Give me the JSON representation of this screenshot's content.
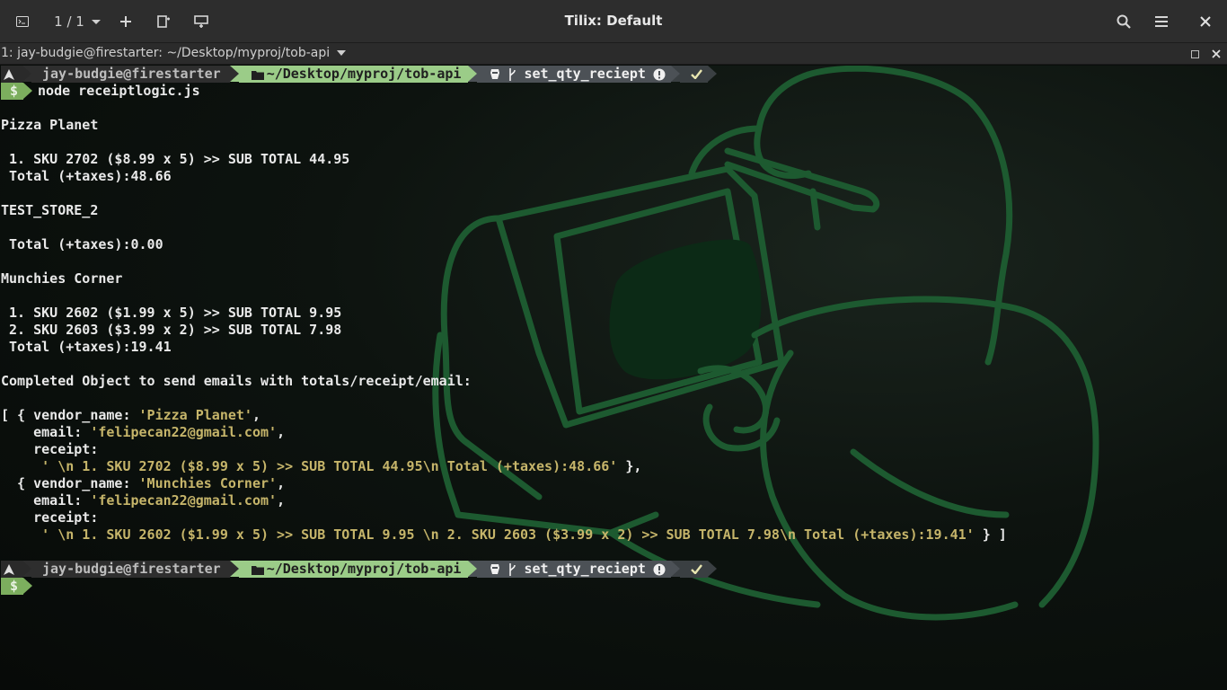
{
  "header": {
    "session_counter": "1 / 1",
    "window_title": "Tilix: Default"
  },
  "terminal_bar": {
    "title": "1: jay-budgie@firestarter: ~/Desktop/myproj/tob-api"
  },
  "prompt": {
    "user_host": "jay-budgie@firestarter",
    "directory": "~/Desktop/myproj/tob-api",
    "branch": "set_qty_reciept",
    "dollar": "$"
  },
  "command": "node receiptlogic.js",
  "output": {
    "store1_name": "Pizza Planet",
    "store1_item1": " 1. SKU 2702 ($8.99 x 5) >> SUB TOTAL 44.95",
    "store1_total": " Total (+taxes):48.66",
    "store2_name": "TEST_STORE_2",
    "store2_total": " Total (+taxes):0.00",
    "store3_name": "Munchies Corner",
    "store3_item1": " 1. SKU 2602 ($1.99 x 5) >> SUB TOTAL 9.95",
    "store3_item2": " 2. SKU 2603 ($3.99 x 2) >> SUB TOTAL 7.98",
    "store3_total": " Total (+taxes):19.41",
    "completed_heading": "Completed Object to send emails with totals/receipt/email:",
    "obj1_vendor_key": "[ { vendor_name: ",
    "obj1_vendor_val": "'Pizza Planet'",
    "obj1_email_key": "    email: ",
    "obj1_email_val": "'felipecan22@gmail.com'",
    "obj_receipt_key": "    receipt:",
    "obj1_receipt_val": "     ' \\n 1. SKU 2702 ($8.99 x 5) >> SUB TOTAL 44.95\\n Total (+taxes):48.66'",
    "obj1_close": " },",
    "obj2_vendor_key": "  { vendor_name: ",
    "obj2_vendor_val": "'Munchies Corner'",
    "obj2_email_key": "    email: ",
    "obj2_email_val": "'felipecan22@gmail.com'",
    "obj2_receipt_val": "     ' \\n 1. SKU 2602 ($1.99 x 5) >> SUB TOTAL 9.95 \\n 2. SKU 2603 ($3.99 x 2) >> SUB TOTAL 7.98\\n Total (+taxes):19.41'",
    "obj2_close": " } ]",
    "comma": ","
  },
  "colors": {
    "prompt_dir_bg": "#9bcc88",
    "prompt_dollar_bg": "#7cae5e",
    "string_color": "#c6b56a",
    "wallpaper_stroke": "#1d5a30"
  },
  "icons": [
    "terminal-icon",
    "plus-icon",
    "add-right-icon",
    "add-down-icon",
    "search-icon",
    "menu-icon",
    "close-icon",
    "arch-icon",
    "folder-icon",
    "git-branch-icon",
    "warning-icon",
    "check-icon"
  ]
}
